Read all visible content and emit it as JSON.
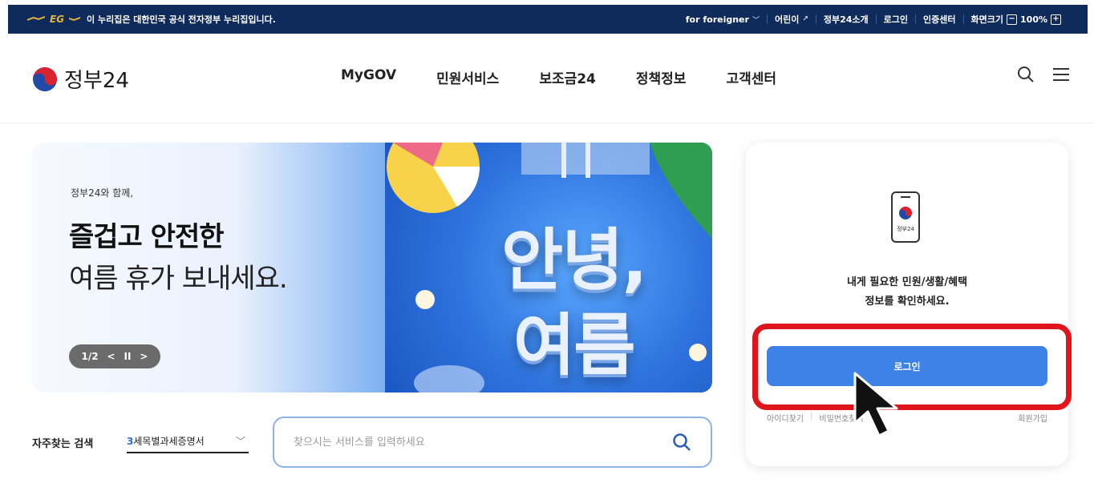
{
  "govbar": {
    "logo_text": "EG",
    "notice": "이 누리집은 대한민국 공식 전자정부 누리집입니다.",
    "links": {
      "foreigner": "for foreigner",
      "kids": "어린이",
      "about": "정부24소개",
      "login": "로그인",
      "cert": "인증센터",
      "screen_size": "화면크기",
      "zoom_minus": "−",
      "zoom": "100%",
      "zoom_plus": "+"
    }
  },
  "header": {
    "logo": "정부24",
    "menu": [
      "MyGOV",
      "민원서비스",
      "보조금24",
      "정책정보",
      "고객센터"
    ],
    "search_icon": "search-icon",
    "menu_icon": "hamburger-icon"
  },
  "banner": {
    "subtitle": "정부24와 함께,",
    "title_line1": "즐겁고 안전한",
    "title_line2": "여름 휴가 보내세요.",
    "pager": {
      "current": "1/2",
      "prev": "<",
      "pause": "II",
      "next": ">"
    },
    "headline1": "안녕,",
    "headline2": "여름"
  },
  "search": {
    "label": "자주찾는 검색",
    "select_number": "3",
    "select_value": "세목별과세증명서",
    "placeholder": "찾으시는 서비스를 입력하세요"
  },
  "login_card": {
    "message_line1": "내게 필요한 민원/생활/혜택",
    "message_line2": "정보를 확인하세요.",
    "phone_label": "정부24",
    "login_button": "로그인",
    "find_id": "아이디찾기",
    "find_pw": "비밀번호찾기",
    "join": "회원가입"
  },
  "colors": {
    "govbar_bg": "#0f2b5b",
    "primary": "#3d82e6",
    "highlight": "#e0141b"
  }
}
